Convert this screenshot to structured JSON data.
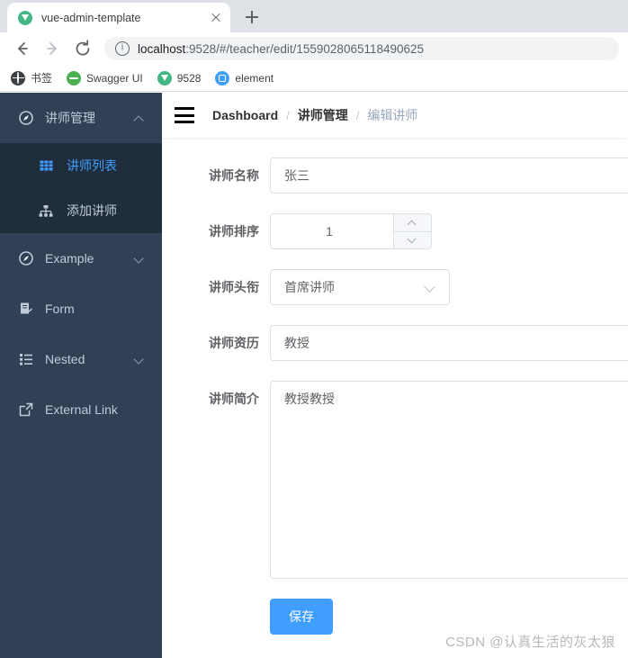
{
  "browser": {
    "tab": {
      "title": "vue-admin-template",
      "favicon": "vue-logo-icon",
      "close": "close-icon"
    },
    "new_tab_label": "+",
    "nav": {
      "back": "back-arrow-icon",
      "forward": "forward-arrow-icon",
      "reload": "reload-icon"
    },
    "omnibox": {
      "info_icon": "info-circle-icon",
      "host": "localhost",
      "path": ":9528/#/teacher/edit/1559028065118490625",
      "full_url": "localhost:9528/#/teacher/edit/1559028065118490625"
    },
    "bookmarks": [
      {
        "label": "书签",
        "icon": "globe-icon"
      },
      {
        "label": "Swagger UI",
        "icon": "swagger-icon"
      },
      {
        "label": "9528",
        "icon": "vue-logo-icon"
      },
      {
        "label": "element",
        "icon": "element-logo-icon"
      }
    ]
  },
  "sidebar": {
    "items": [
      {
        "label": "讲师管理",
        "icon": "compass-icon",
        "arrow": "chevron-up-icon",
        "expanded": true,
        "children": [
          {
            "label": "讲师列表",
            "icon": "table-icon",
            "active": true
          },
          {
            "label": "添加讲师",
            "icon": "tree-icon",
            "active": false
          }
        ]
      },
      {
        "label": "Example",
        "icon": "compass-icon",
        "arrow": "chevron-down-icon",
        "expanded": false
      },
      {
        "label": "Form",
        "icon": "form-icon",
        "arrow": "",
        "expanded": false
      },
      {
        "label": "Nested",
        "icon": "nested-list-icon",
        "arrow": "chevron-down-icon",
        "expanded": false
      },
      {
        "label": "External Link",
        "icon": "external-link-icon",
        "arrow": "",
        "expanded": false
      }
    ]
  },
  "navbar": {
    "hamburger": "hamburger-icon",
    "breadcrumb": [
      {
        "label": "Dashboard",
        "current": false
      },
      {
        "label": "讲师管理",
        "current": false
      },
      {
        "label": "编辑讲师",
        "current": true
      }
    ],
    "separator": "/"
  },
  "form": {
    "fields": {
      "name": {
        "label": "讲师名称",
        "value": "张三"
      },
      "sort": {
        "label": "讲师排序",
        "value": "1",
        "increase_icon": "chevron-up-icon",
        "decrease_icon": "chevron-down-icon"
      },
      "title": {
        "label": "讲师头衔",
        "value": "首席讲师",
        "arrow_icon": "chevron-down-icon"
      },
      "level": {
        "label": "讲师资历",
        "value": "教授"
      },
      "intro": {
        "label": "讲师简介",
        "value": "教授教授"
      }
    },
    "save_button": "保存"
  },
  "watermark": "CSDN @认真生活的灰太狼",
  "colors": {
    "accent": "#409EFF",
    "sidebar_bg": "#304156",
    "submenu_bg": "#1F2D3D",
    "sidebar_text": "#BFCBD9",
    "label_text": "#606266",
    "border": "#DCDFE6"
  }
}
